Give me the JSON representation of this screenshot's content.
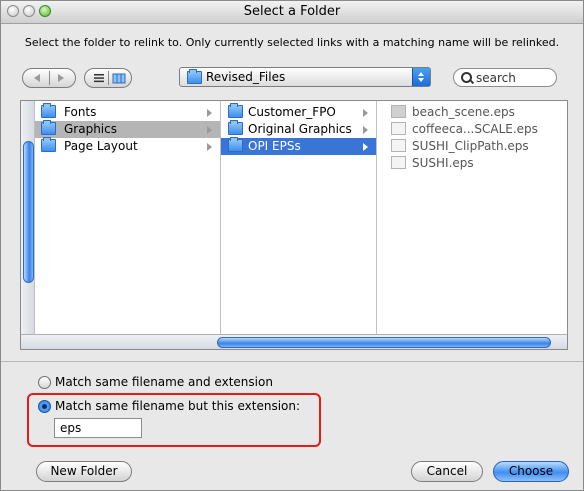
{
  "window": {
    "title": "Select a Folder",
    "instruction": "Select the folder to relink to. Only currently selected links with a matching name will be relinked."
  },
  "toolbar": {
    "path_label": "Revised_Files",
    "search_placeholder": "search"
  },
  "columns": [
    {
      "items": [
        {
          "label": "Fonts",
          "icon": "folder-icon",
          "selected": false,
          "has_children": true
        },
        {
          "label": "Graphics",
          "icon": "folder-icon",
          "selected": true,
          "has_children": true
        },
        {
          "label": "Page Layout",
          "icon": "folder-icon",
          "selected": false,
          "has_children": true
        }
      ]
    },
    {
      "items": [
        {
          "label": "Customer_FPO",
          "icon": "folder-icon",
          "selected": false,
          "has_children": true
        },
        {
          "label": "Original Graphics",
          "icon": "folder-icon",
          "selected": false,
          "has_children": true
        },
        {
          "label": "OPI EPSs",
          "icon": "folder-icon",
          "selected": true,
          "has_children": true
        }
      ]
    },
    {
      "items": [
        {
          "label": "beach_scene.eps",
          "icon": "file-icon"
        },
        {
          "label": "coffeeca...SCALE.eps",
          "icon": "file-icon"
        },
        {
          "label": "SUSHI_ClipPath.eps",
          "icon": "file-icon"
        },
        {
          "label": "SUSHI.eps",
          "icon": "file-icon"
        }
      ]
    }
  ],
  "options": {
    "match_ext_label": "Match same filename and extension",
    "match_name_label": "Match same filename but this extension:",
    "selected": "match_name",
    "extension_value": "eps"
  },
  "buttons": {
    "new_folder": "New Folder",
    "cancel": "Cancel",
    "choose": "Choose"
  },
  "colors": {
    "selection_blue": "#3875d7",
    "selection_grey": "#b5b5b5",
    "highlight_red": "#e21b1b"
  }
}
